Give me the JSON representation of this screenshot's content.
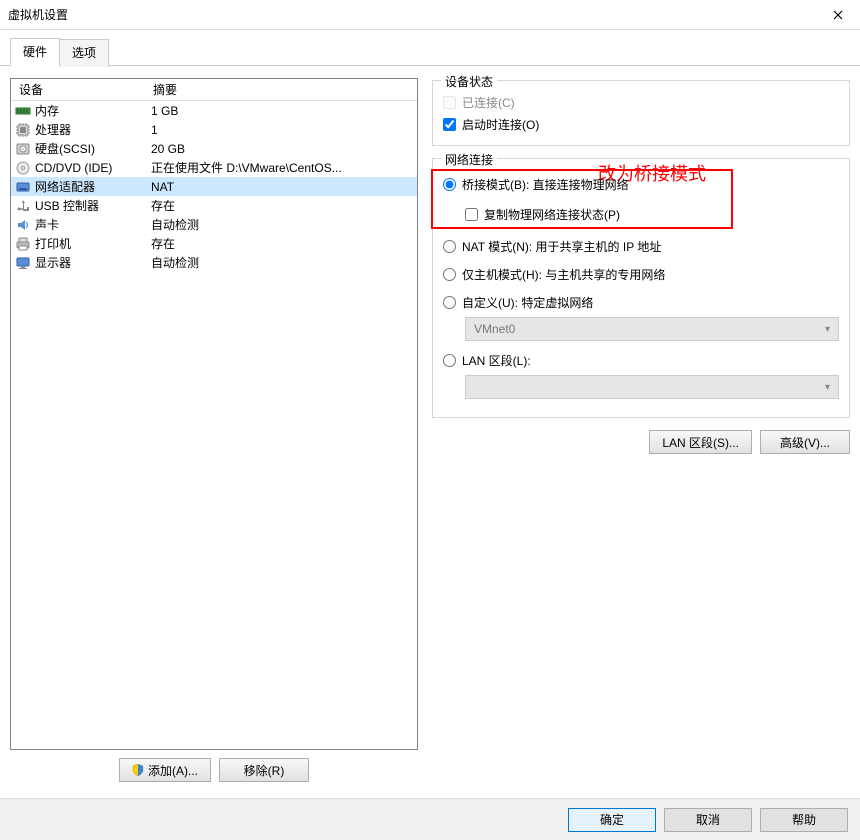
{
  "window": {
    "title": "虚拟机设置"
  },
  "tabs": [
    {
      "label": "硬件",
      "active": true
    },
    {
      "label": "选项",
      "active": false
    }
  ],
  "devlist": {
    "header_device": "设备",
    "header_summary": "摘要",
    "rows": [
      {
        "icon": "memory-icon",
        "name": "内存",
        "summary": "1 GB"
      },
      {
        "icon": "cpu-icon",
        "name": "处理器",
        "summary": "1"
      },
      {
        "icon": "disk-icon",
        "name": "硬盘(SCSI)",
        "summary": "20 GB"
      },
      {
        "icon": "cd-icon",
        "name": "CD/DVD (IDE)",
        "summary": "正在使用文件 D:\\VMware\\CentOS..."
      },
      {
        "icon": "nic-icon",
        "name": "网络适配器",
        "summary": "NAT",
        "selected": true
      },
      {
        "icon": "usb-icon",
        "name": "USB 控制器",
        "summary": "存在"
      },
      {
        "icon": "sound-icon",
        "name": "声卡",
        "summary": "自动检测"
      },
      {
        "icon": "printer-icon",
        "name": "打印机",
        "summary": "存在"
      },
      {
        "icon": "display-icon",
        "name": "显示器",
        "summary": "自动检测"
      }
    ]
  },
  "left_buttons": {
    "add": "添加(A)...",
    "remove": "移除(R)"
  },
  "device_state": {
    "title": "设备状态",
    "connected": "已连接(C)",
    "connect_at_poweron": "启动时连接(O)"
  },
  "annotation": "改为桥接模式",
  "netconn": {
    "title": "网络连接",
    "bridged": "桥接模式(B): 直接连接物理网络",
    "replicate": "复制物理网络连接状态(P)",
    "nat": "NAT 模式(N): 用于共享主机的 IP 地址",
    "hostonly": "仅主机模式(H): 与主机共享的专用网络",
    "custom": "自定义(U): 特定虚拟网络",
    "custom_value": "VMnet0",
    "lanseg": "LAN 区段(L):"
  },
  "right_buttons": {
    "lanseg": "LAN 区段(S)...",
    "advanced": "高级(V)..."
  },
  "bottom": {
    "ok": "确定",
    "cancel": "取消",
    "help": "帮助"
  }
}
